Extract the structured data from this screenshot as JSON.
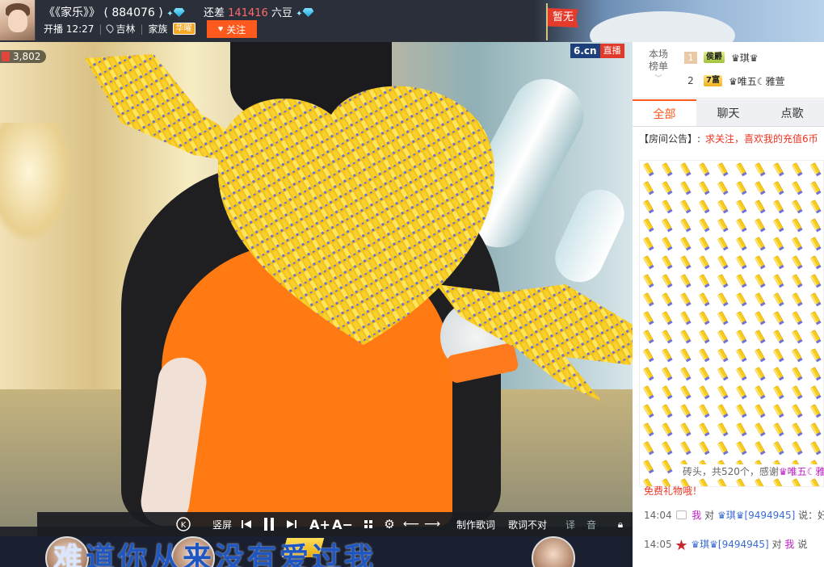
{
  "header": {
    "anchor_name": "《《家乐》》",
    "room_id": "( 884076 )",
    "gap_label": "还差",
    "gap_value": "141416",
    "gap_unit": "六豆",
    "live_time": "开播 12:27",
    "location": "吉林",
    "family_label": "家族",
    "family_badge": "华曜",
    "follow_label": "关注",
    "flag_label": "暂无"
  },
  "video": {
    "viewer_count": "3,802",
    "logo_text": "6.cn",
    "live_label": "直播"
  },
  "controls": {
    "vertical_label": "竖屏",
    "make_lyrics": "制作歌词",
    "lyrics_wrong": "歌词不对",
    "translate": "译",
    "sound": "音"
  },
  "karaoke": {
    "lyric_lit": "难",
    "lyric_rest": "道你从来没有爱过我"
  },
  "rank": {
    "title_line1": "本场",
    "title_line2": "榜单",
    "items": [
      {
        "rank": "1",
        "level": "侯爵",
        "name": "♛琪♛"
      },
      {
        "rank": "2",
        "level": "7富",
        "name": "♛唯五☾雅萱"
      }
    ]
  },
  "tabs": [
    "全部",
    "聊天",
    "点歌"
  ],
  "notice": {
    "label": "【房间公告】:",
    "text": "求关注，喜欢我的充值6币"
  },
  "gift_line": {
    "text": "砖头，共520个，感谢",
    "user": "♛唯五☾雅萱"
  },
  "chat": {
    "cut_text": "免费礼物哦！",
    "lines": [
      {
        "time": "14:04",
        "who": "我",
        "verb": "对",
        "target": "♛琪♛[9494945]",
        "tail": "说：好"
      },
      {
        "time": "14:05",
        "who": "♛琪♛[9494945]",
        "verb": "对",
        "target": "我",
        "tail": "说"
      }
    ]
  },
  "colors": {
    "accent": "#ff5a1e",
    "gap_value": "#ff6b6b",
    "notice": "#ee3322"
  }
}
